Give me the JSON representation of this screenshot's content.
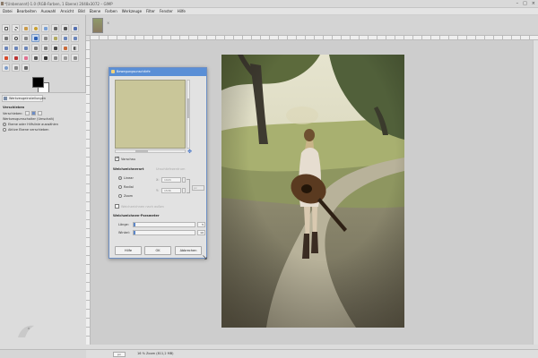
{
  "window": {
    "title": "*[Unbenannt]-1.0 (RGB-Farben, 1 Ebene) 2048x3072 – GIMP",
    "controls": [
      "–",
      "□",
      "×"
    ]
  },
  "menubar": [
    "Datei",
    "Bearbeiten",
    "Auswahl",
    "Ansicht",
    "Bild",
    "Ebene",
    "Farben",
    "Werkzeuge",
    "Filter",
    "Fenster",
    "Hilfe"
  ],
  "colors": {
    "foreground": "#000000",
    "background": "#ffffff",
    "accent": "#5a8fd6"
  },
  "tool_options": {
    "tab": "Werkzeugeinstellungen",
    "heading": "Verschieben",
    "move_label": "Verschieben:",
    "toggle_label": "Werkzeugumschalter (Umschalt)",
    "options": [
      {
        "label": "Ebene oder Hilfslinie auswählen",
        "selected": true
      },
      {
        "label": "Aktive Ebene verschieben",
        "selected": false
      }
    ]
  },
  "image_tab": {
    "close": "×"
  },
  "statusbar": {
    "unit": "px",
    "zoom": "16 %",
    "info": "Zoom (811,2 MB)"
  },
  "dialog": {
    "title": "Bewegungsunschärfe",
    "preview_label": "Vorschau",
    "preview_checked": true,
    "blur_type_heading": "Weichzeichnerart",
    "blur_center_heading": "Unschärfezentrum",
    "blur_types": [
      {
        "label": "Linear",
        "selected": true
      },
      {
        "label": "Radial",
        "selected": false
      },
      {
        "label": "Zoom",
        "selected": false
      }
    ],
    "center_x_label": "X:",
    "center_x_value": "1024",
    "center_y_label": "Y:",
    "center_y_value": "1536",
    "center_unit": "px",
    "blur_outward_label": "Weichzeichnen nach außen",
    "params_heading": "Weichzeichnen-Parameter",
    "length_label": "Länge:",
    "length_value": "5",
    "length_fraction": 0.03,
    "angle_label": "Winkel:",
    "angle_value": "10",
    "angle_fraction": 0.03,
    "buttons": {
      "help": "Hilfe",
      "ok": "OK",
      "cancel": "Abbrechen"
    }
  }
}
